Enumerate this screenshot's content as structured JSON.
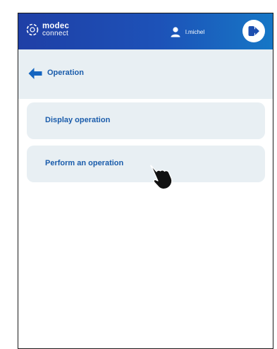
{
  "header": {
    "logo": {
      "line1": "modec",
      "line2": "connect"
    },
    "username": "l.michel",
    "icons": {
      "user": "user-icon",
      "logout": "logout-icon"
    }
  },
  "subheader": {
    "title": "Operation",
    "back_icon": "arrow-left-icon"
  },
  "menu": {
    "items": [
      {
        "label": "Display operation"
      },
      {
        "label": "Perform an operation"
      }
    ]
  },
  "colors": {
    "header_start": "#1f3fa6",
    "header_end": "#1677c6",
    "panel_bg": "#e8eff3",
    "accent_text": "#1a5cab"
  }
}
